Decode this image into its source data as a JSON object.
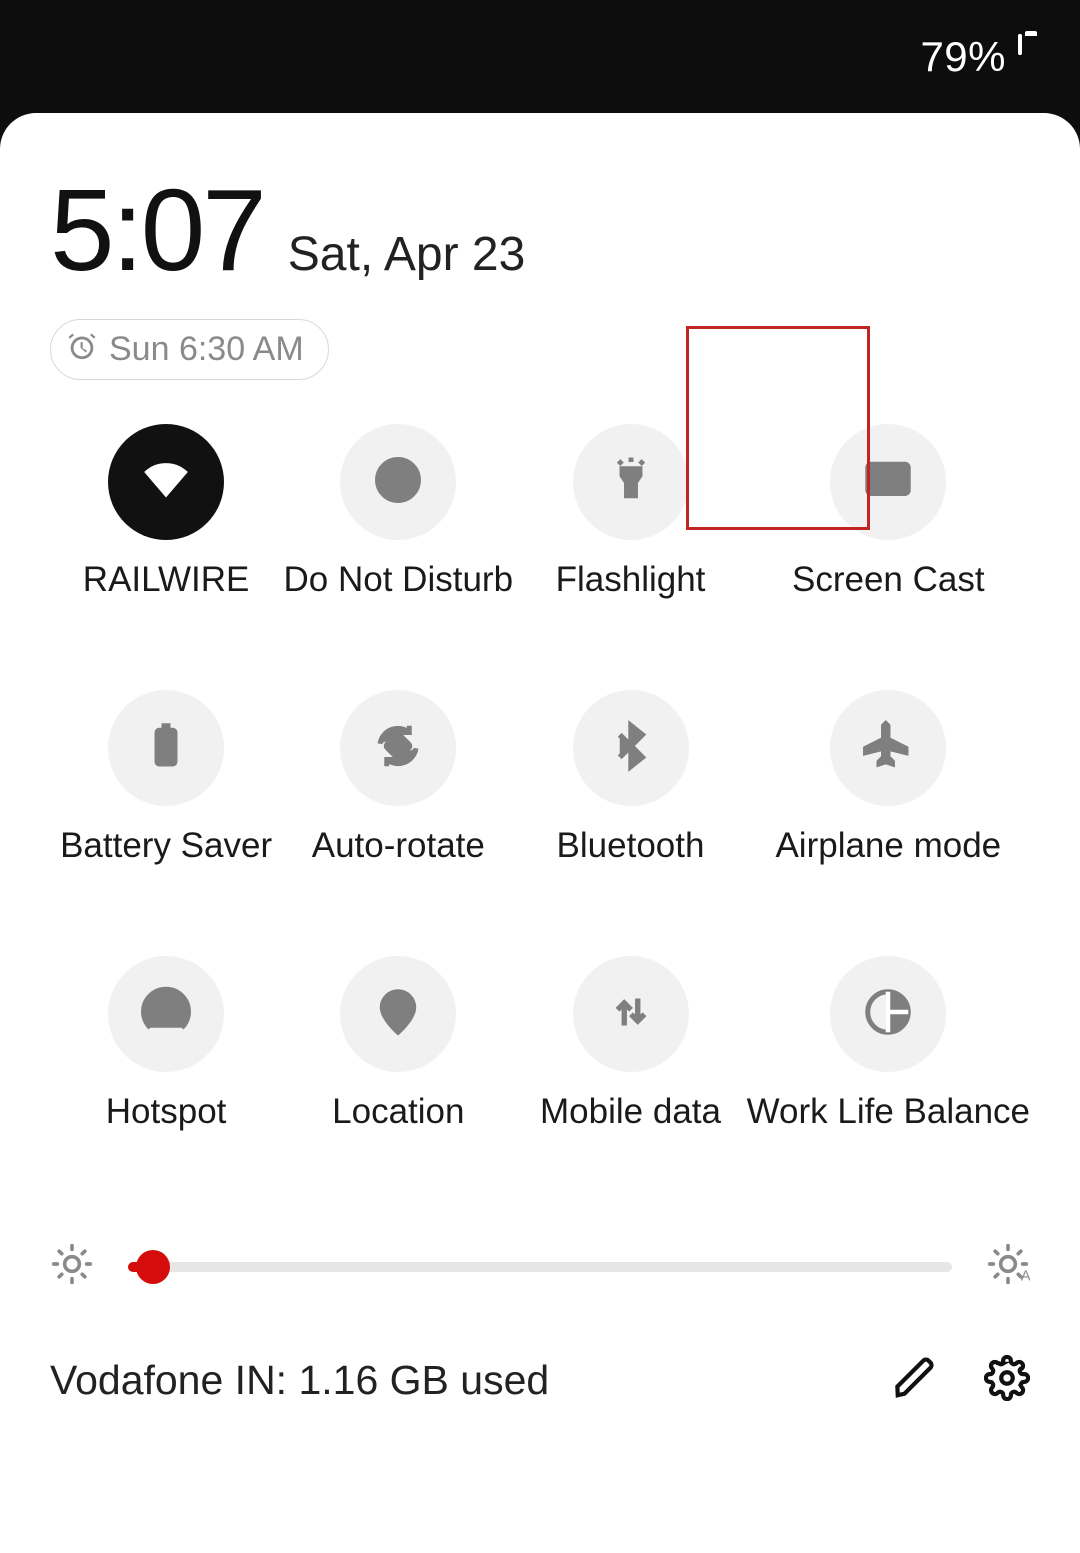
{
  "status": {
    "battery_pct": "79%"
  },
  "panel": {
    "time": "5:07",
    "date": "Sat, Apr 23",
    "alarm_label": "Sun 6:30 AM",
    "data_usage": "Vodafone IN: 1.16 GB used"
  },
  "tiles": [
    {
      "id": "wifi",
      "label": "RAILWIRE",
      "active": true
    },
    {
      "id": "dnd",
      "label": "Do Not Disturb",
      "active": false
    },
    {
      "id": "flashlight",
      "label": "Flashlight",
      "active": false
    },
    {
      "id": "screencast",
      "label": "Screen Cast",
      "active": false,
      "highlighted": true
    },
    {
      "id": "batterysaver",
      "label": "Battery Saver",
      "active": false
    },
    {
      "id": "autorotate",
      "label": "Auto-rotate",
      "active": false
    },
    {
      "id": "bluetooth",
      "label": "Bluetooth",
      "active": false
    },
    {
      "id": "airplane",
      "label": "Airplane mode",
      "active": false
    },
    {
      "id": "hotspot",
      "label": "Hotspot",
      "active": false
    },
    {
      "id": "location",
      "label": "Location",
      "active": false
    },
    {
      "id": "mobiledata",
      "label": "Mobile data",
      "active": false
    },
    {
      "id": "worklife",
      "label": "Work Life Balance",
      "active": false
    }
  ],
  "brightness": {
    "percent": 3
  },
  "colors": {
    "accent": "#d40c0c",
    "tile_on": "#111111",
    "tile_off": "#f1f1f1",
    "highlight": "#c02424"
  }
}
